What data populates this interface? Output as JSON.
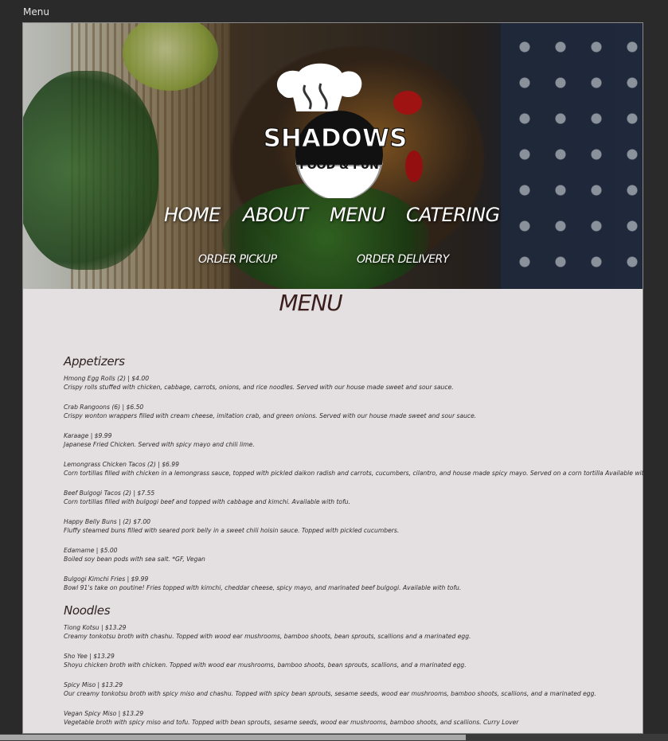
{
  "window": {
    "menu_label": "Menu"
  },
  "logo": {
    "brand": "SHADOWS",
    "tagline": "FOOD & FUN"
  },
  "nav": {
    "home": "HOME",
    "about": "ABOUT",
    "menu": "MENU",
    "catering": "CATERING",
    "order_pickup": "ORDER PICKUP",
    "order_delivery": "ORDER DELIVERY"
  },
  "page_title": "MENU",
  "sections": {
    "appetizers": {
      "heading": "Appetizers",
      "items": [
        {
          "name": "Hmong Egg Rolls (2) | $4.00",
          "desc": "Crispy rolls stuffed with chicken, cabbage, carrots, onions, and rice noodles. Served with our house made sweet and sour sauce."
        },
        {
          "name": "Crab Rangoons (6) | $6.50",
          "desc": "Crispy wonton wrappers filled with cream cheese, imitation crab, and green onions. Served with our house made sweet and sour sauce."
        },
        {
          "name": "Karaage | $9.99",
          "desc": "Japanese Fried Chicken. Served with spicy mayo and chili lime."
        },
        {
          "name": "Lemongrass Chicken Tacos (2) | $6.99",
          "desc": "Corn tortillas filled with chicken in a lemongrass sauce, topped with pickled daikon radish and carrots, cucumbers, cilantro, and house made spicy mayo. Served on a corn tortilla Available with tofu *GF"
        },
        {
          "name": "Beef Bulgogi Tacos (2) | $7.55",
          "desc": "Corn tortillas filled with bulgogi beef and topped with cabbage and kimchi. Available with tofu."
        },
        {
          "name": "Happy Belly Buns | (2) $7.00",
          "desc": "Fluffy steamed buns filled with seared pork belly in a sweet chili hoisin sauce. Topped with pickled cucumbers."
        },
        {
          "name": "Edamame | $5.00",
          "desc": "Boiled soy bean pods with sea salt. *GF, Vegan"
        },
        {
          "name": "Bulgogi Kimchi Fries | $9.99",
          "desc": "Bowl 91's take on poutine! Fries topped with kimchi, cheddar cheese, spicy mayo, and marinated beef bulgogi. Available with tofu."
        }
      ]
    },
    "noodles": {
      "heading": "Noodles",
      "items": [
        {
          "name": "Tiong Kotsu | $13.29",
          "desc": "Creamy tonkotsu broth with chashu. Topped with wood ear mushrooms, bamboo shoots, bean sprouts, scallions and a marinated egg."
        },
        {
          "name": "Sho Yee | $13.29",
          "desc": "Shoyu chicken broth with chicken. Topped with wood ear mushrooms, bamboo shoots, bean sprouts, scallions, and a marinated egg."
        },
        {
          "name": "Spicy Miso | $13.29",
          "desc": "Our creamy tonkotsu broth with spicy miso and chashu. Topped with spicy bean sprouts, sesame seeds, wood ear mushrooms, bamboo shoots, scallions, and a marinated egg."
        },
        {
          "name": "Vegan Spicy Miso | $13.29",
          "desc": "Vegetable broth with spicy miso and tofu. Topped with bean sprouts, sesame seeds, wood ear mushrooms, bamboo shoots, and scallions. Curry Lover"
        }
      ]
    }
  },
  "colors": {
    "page_bg": "#e4dfe0",
    "title": "#3a1d1d",
    "frame": "#2a2a2a"
  }
}
